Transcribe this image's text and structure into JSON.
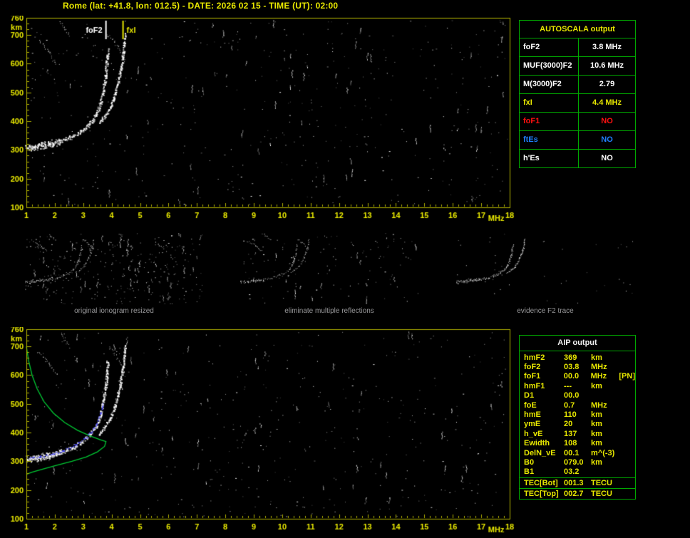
{
  "header": {
    "title": "Rome (lat: +41.8, lon: 012.5) - DATE: 2026 02 15 - TIME (UT): 02:00"
  },
  "autoscala": {
    "title": "AUTOSCALA output",
    "rows": [
      {
        "param": "foF2",
        "value": "3.8 MHz",
        "color": "#ffffff"
      },
      {
        "param": "MUF(3000)F2",
        "value": "10.6 MHz",
        "color": "#ffffff"
      },
      {
        "param": "M(3000)F2",
        "value": "2.79",
        "color": "#ffffff"
      },
      {
        "param": "fxI",
        "value": "4.4 MHz",
        "color": "#e8e800"
      },
      {
        "param": "foF1",
        "value": "NO",
        "color": "#ff1010"
      },
      {
        "param": "ftEs",
        "value": "NO",
        "color": "#2080ff"
      },
      {
        "param": "h'Es",
        "value": "NO",
        "color": "#ffffff"
      }
    ]
  },
  "thumbnails": [
    {
      "caption": "original ionogram resized"
    },
    {
      "caption": "eliminate multiple reflections"
    },
    {
      "caption": "evidence F2 trace"
    }
  ],
  "aip": {
    "title": "AIP output",
    "rows": [
      {
        "param": "hmF2",
        "value": "369",
        "unit": "km",
        "note": ""
      },
      {
        "param": "foF2",
        "value": "03.8",
        "unit": "MHz",
        "note": ""
      },
      {
        "param": "foF1",
        "value": "00.0",
        "unit": "MHz",
        "note": "[PN]"
      },
      {
        "param": "hmF1",
        "value": "---",
        "unit": "km",
        "note": ""
      },
      {
        "param": "D1",
        "value": "00.0",
        "unit": "",
        "note": ""
      },
      {
        "param": "foE",
        "value": "0.7",
        "unit": "MHz",
        "note": ""
      },
      {
        "param": "hmE",
        "value": "110",
        "unit": "km",
        "note": ""
      },
      {
        "param": "ymE",
        "value": "20",
        "unit": "km",
        "note": ""
      },
      {
        "param": "h_vE",
        "value": "137",
        "unit": "km",
        "note": ""
      },
      {
        "param": "Ewidth",
        "value": "108",
        "unit": "km",
        "note": ""
      },
      {
        "param": "DelN_vE",
        "value": "00.1",
        "unit": "m^(-3)",
        "note": ""
      },
      {
        "param": "B0",
        "value": "079.0",
        "unit": "km",
        "note": ""
      },
      {
        "param": "B1",
        "value": "03.2",
        "unit": "",
        "note": ""
      }
    ],
    "tec_rows": [
      {
        "param": "TEC[Bot]",
        "value": "001.3",
        "unit": "TECU"
      },
      {
        "param": "TEC[Top]",
        "value": "002.7",
        "unit": "TECU"
      }
    ]
  },
  "chart_data": {
    "type": "scatter",
    "title": "ionogram (virtual height vs frequency)",
    "x_range": [
      1,
      18
    ],
    "y_range": [
      100,
      760
    ],
    "x_ticks": [
      1,
      2,
      3,
      4,
      5,
      6,
      7,
      8,
      9,
      10,
      11,
      12,
      13,
      14,
      15,
      16,
      17,
      18
    ],
    "y_ticks": [
      760,
      700,
      600,
      500,
      400,
      300,
      200,
      100
    ],
    "x_unit": "MHz",
    "y_unit": "km",
    "markers": [
      {
        "label": "foF2",
        "freq": 3.8,
        "color": "#ffffff"
      },
      {
        "label": "fxI",
        "freq": 4.4,
        "color": "#e8e800"
      }
    ],
    "band": [
      [
        1.0,
        308
      ],
      [
        1.6,
        318
      ],
      [
        2.2,
        332
      ]
    ],
    "o_trace": [
      [
        1.0,
        308
      ],
      [
        1.4,
        315
      ],
      [
        1.8,
        322
      ],
      [
        2.2,
        332
      ],
      [
        2.6,
        348
      ],
      [
        2.9,
        365
      ],
      [
        3.2,
        390
      ],
      [
        3.45,
        425
      ],
      [
        3.6,
        465
      ],
      [
        3.7,
        510
      ],
      [
        3.78,
        560
      ],
      [
        3.82,
        610
      ],
      [
        3.85,
        648
      ]
    ],
    "x_trace": [
      [
        3.55,
        395
      ],
      [
        3.75,
        420
      ],
      [
        3.95,
        450
      ],
      [
        4.1,
        490
      ],
      [
        4.2,
        530
      ],
      [
        4.3,
        575
      ],
      [
        4.38,
        625
      ],
      [
        4.43,
        672
      ],
      [
        4.46,
        702
      ]
    ],
    "extra_segments": [
      [
        [
          1.45,
          685
        ],
        [
          1.8,
          640
        ],
        [
          2.05,
          600
        ]
      ],
      [
        [
          2.2,
          750
        ],
        [
          2.5,
          700
        ]
      ],
      [
        [
          3.9,
          700
        ],
        [
          4.2,
          660
        ],
        [
          4.45,
          610
        ]
      ]
    ],
    "profile": [
      [
        1.0,
        700
      ],
      [
        1.08,
        650
      ],
      [
        1.2,
        600
      ],
      [
        1.38,
        552
      ],
      [
        1.62,
        508
      ],
      [
        1.95,
        468
      ],
      [
        2.35,
        435
      ],
      [
        2.8,
        408
      ],
      [
        3.25,
        388
      ],
      [
        3.6,
        375
      ],
      [
        3.8,
        369
      ],
      [
        3.75,
        352
      ],
      [
        3.5,
        333
      ],
      [
        3.1,
        315
      ],
      [
        2.6,
        300
      ],
      [
        2.05,
        286
      ],
      [
        1.55,
        272
      ],
      [
        1.2,
        262
      ],
      [
        1.0,
        255
      ]
    ],
    "restored_trace": [
      [
        1.1,
        312
      ],
      [
        1.5,
        318
      ],
      [
        1.9,
        327
      ],
      [
        2.3,
        340
      ],
      [
        2.7,
        357
      ],
      [
        3.0,
        378
      ],
      [
        3.25,
        402
      ],
      [
        3.45,
        432
      ],
      [
        3.6,
        468
      ],
      [
        3.7,
        505
      ]
    ],
    "colors": {
      "axis": "#b0b000",
      "tick_label": "#e8e800",
      "noise": "#ffffff",
      "profile": "#00c832",
      "restored": "#4646ff",
      "table_border": "#00a800"
    }
  }
}
